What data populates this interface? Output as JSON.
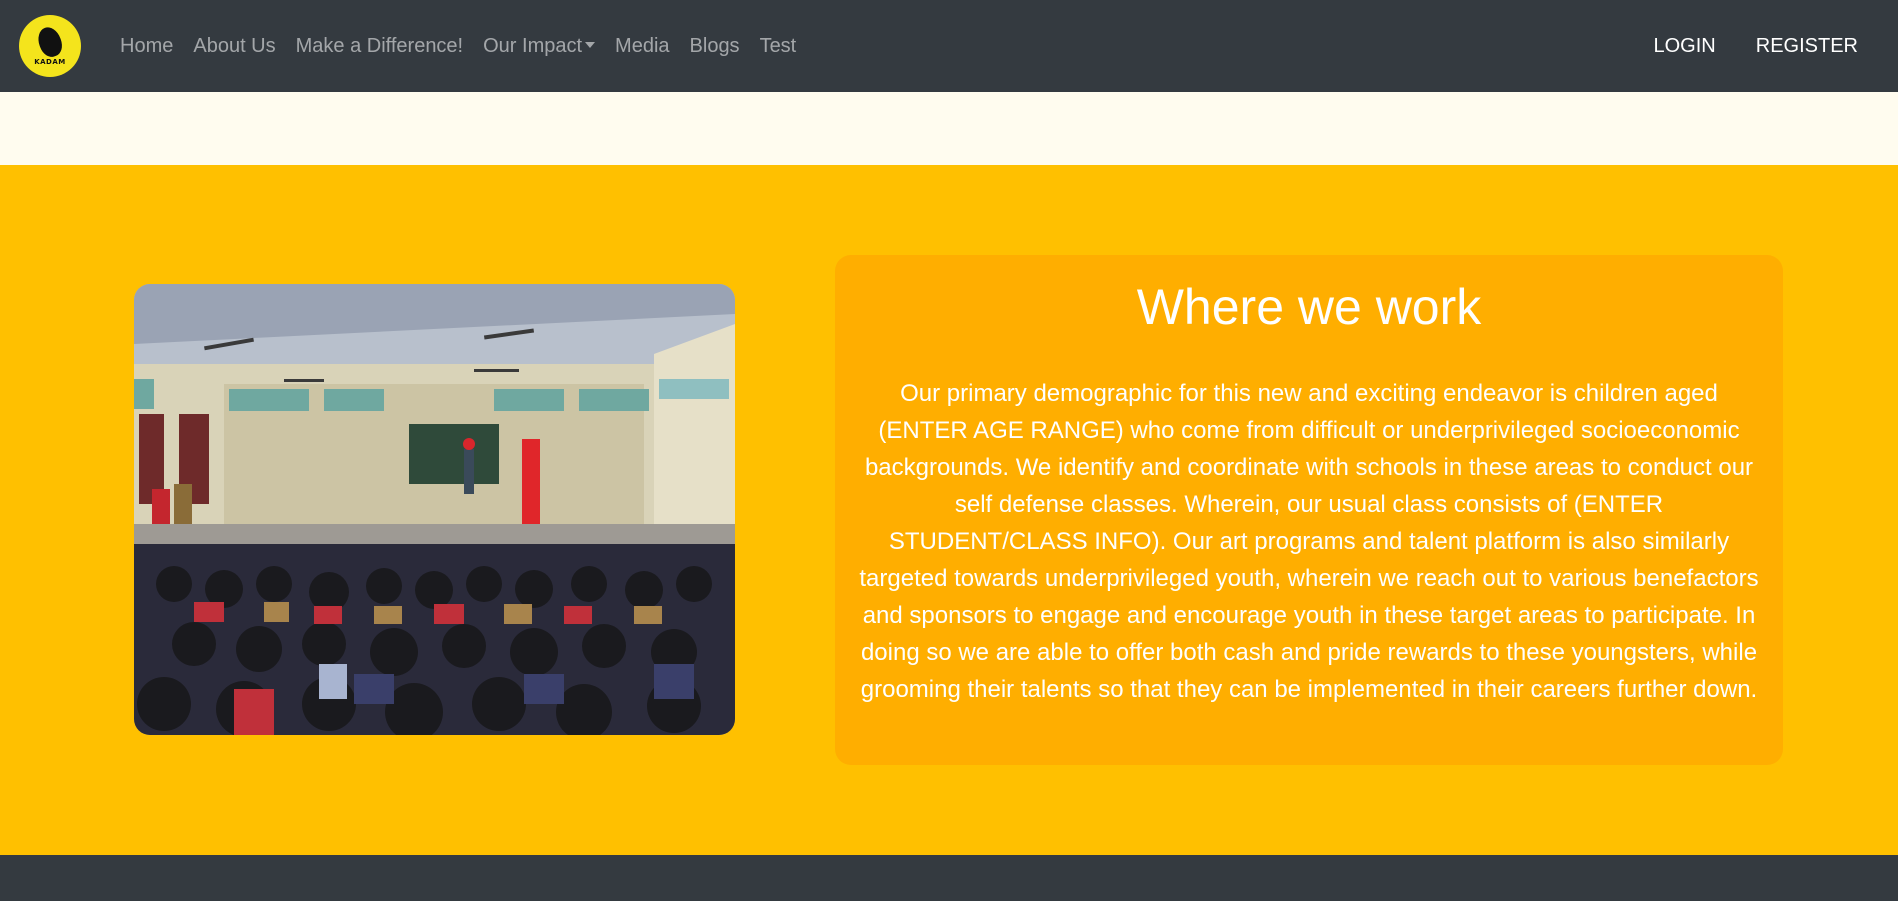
{
  "nav": {
    "brand_text": "KADAM",
    "links": [
      "Home",
      "About Us",
      "Make a Difference!",
      "Our Impact",
      "Media",
      "Blogs",
      "Test"
    ],
    "login": "LOGIN",
    "register": "REGISTER"
  },
  "colors": {
    "navbar": "#343a40",
    "cream": "#fffcef",
    "section": "#ffc000",
    "card": "#ffae00",
    "logo": "#f4e41c"
  },
  "section": {
    "title": "Where we work",
    "body": "Our primary demographic for this new and exciting endeavor is children aged (ENTER AGE RANGE) who come from difficult or underprivileged socioeconomic backgrounds. We identify and coordinate with schools in these areas to conduct our self defense classes. Wherein, our usual class consists of (ENTER STUDENT/CLASS INFO). Our art programs and talent platform is also similarly targeted towards underprivileged youth, wherein we reach out to various benefactors and sponsors to engage and encourage youth in these target areas to participate. In doing so we are able to offer both cash and pride rewards to these youngsters, while grooming their talents so that they can be implemented in their careers further down."
  },
  "icons": {
    "logo": "footprint-logo-icon",
    "dropdown": "caret-down-icon"
  }
}
